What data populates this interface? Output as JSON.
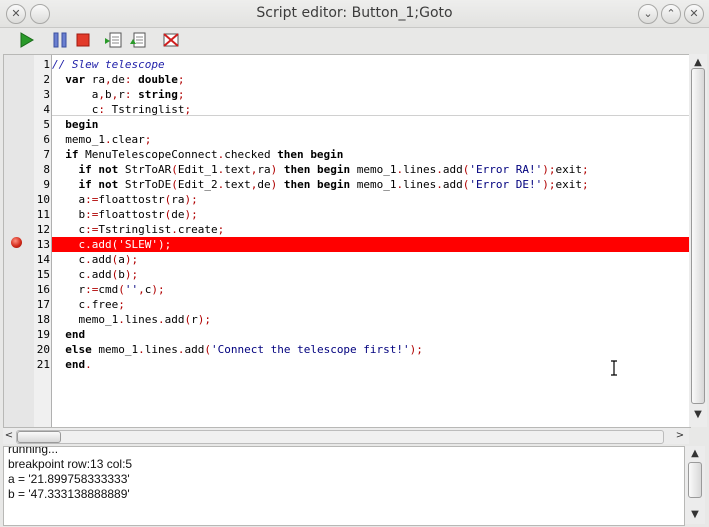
{
  "window": {
    "title": "Script editor: Button_1;Goto"
  },
  "titlebar_buttons": {
    "left": "✕",
    "left2": "⌄",
    "min": "⌄",
    "max": "⌃",
    "close": "✕"
  },
  "toolbar": {
    "run": "run",
    "pause": "pause",
    "stop": "stop",
    "step_into": "step-into",
    "step_over": "step-over",
    "clear_breakpoints": "clear-breakpoints"
  },
  "editor": {
    "lines": [
      "// Slew telescope",
      "  var ra,de: double;",
      "      a,b,r: string;",
      "      c: Tstringlist;",
      "  begin",
      "  memo_1.clear;",
      "  if MenuTelescopeConnect.checked then begin",
      "    if not StrToAR(Edit_1.text,ra) then begin memo_1.lines.add('Error RA!');exit;",
      "    if not StrToDE(Edit_2.text,de) then begin memo_1.lines.add('Error DE!');exit;",
      "    a:=floattostr(ra);",
      "    b:=floattostr(de);",
      "    c:=Tstringlist.create;",
      "    c.add('SLEW');",
      "    c.add(a);",
      "    c.add(b);",
      "    r:=cmd('',c);",
      "    c.free;",
      "    memo_1.lines.add(r);",
      "  end",
      "  else memo_1.lines.add('Connect the telescope first!');",
      "  end."
    ],
    "line_numbers": [
      "1",
      "2",
      "3",
      "4",
      "5",
      "6",
      "7",
      "8",
      "9",
      "10",
      "11",
      "12",
      "13",
      "14",
      "15",
      "16",
      "17",
      "18",
      "19",
      "20",
      "21"
    ],
    "breakpoint_line": 13
  },
  "output": {
    "lines": [
      "running...",
      "breakpoint row:13 col:5",
      "a = '21.899758333333'",
      "b = '47.333138888889'"
    ]
  },
  "colors": {
    "breakpoint": "#ff0000",
    "keyword": "#000000",
    "comment": "#1e1ea8",
    "string": "#00007e"
  },
  "icons": {
    "scroll_up": "▲",
    "scroll_down": "▼",
    "scroll_left": "<",
    "scroll_right": ">"
  }
}
